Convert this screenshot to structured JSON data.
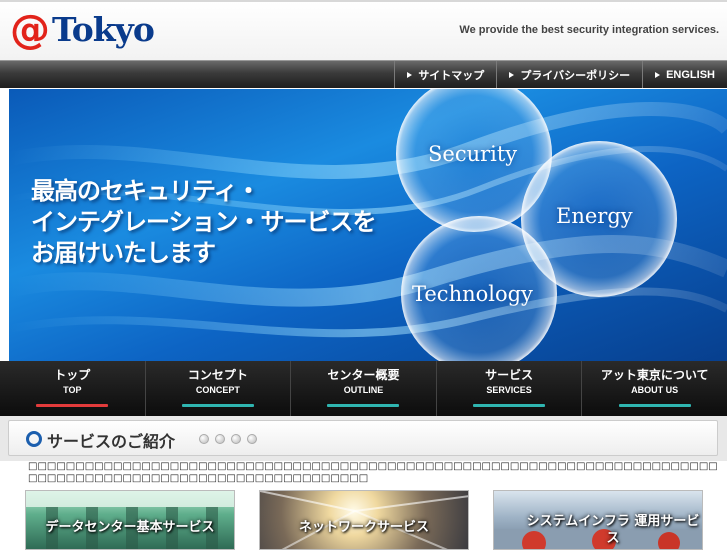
{
  "header": {
    "logo_at": "@",
    "logo_text": "Tokyo",
    "tagline": "We provide the best security integration services."
  },
  "utility_links": [
    {
      "label": "サイトマップ"
    },
    {
      "label": "プライバシーポリシー"
    },
    {
      "label": "ENGLISH"
    }
  ],
  "hero": {
    "lines": [
      "最高のセキュリティ・",
      "インテグレーション・サービスを",
      "お届けいたします"
    ],
    "circles": [
      "Security",
      "Energy",
      "Technology"
    ]
  },
  "nav": [
    {
      "jp": "トップ",
      "en": "TOP",
      "bar_color": "#e23b3b"
    },
    {
      "jp": "コンセプト",
      "en": "CONCEPT",
      "bar_color": "#2fb5b0"
    },
    {
      "jp": "センター概要",
      "en": "OUTLINE",
      "bar_color": "#2fb5b0"
    },
    {
      "jp": "サービス",
      "en": "SERVICES",
      "bar_color": "#2fb5b0"
    },
    {
      "jp": "アット東京について",
      "en": "ABOUT US",
      "bar_color": "#2fb5b0"
    }
  ],
  "section": {
    "title": "サービスのご紹介",
    "body": "□□□□□□□□□□□□□□□□□□□□□□□□□□□□□□□□□□□□□□□□□□□□□□□□□□□□□□□□□□□□□□□□□□□□□□□□□□□□□□□□□□□□□□□□□□□□□□□□□□□□□□□□□□□□□"
  },
  "cards": [
    {
      "label": "データセンター基本サービス"
    },
    {
      "label": "ネットワークサービス"
    },
    {
      "label": "システムインフラ 運用サービス"
    }
  ],
  "colors": {
    "brand_red": "#e2231a",
    "brand_blue": "#0a3b8c"
  }
}
